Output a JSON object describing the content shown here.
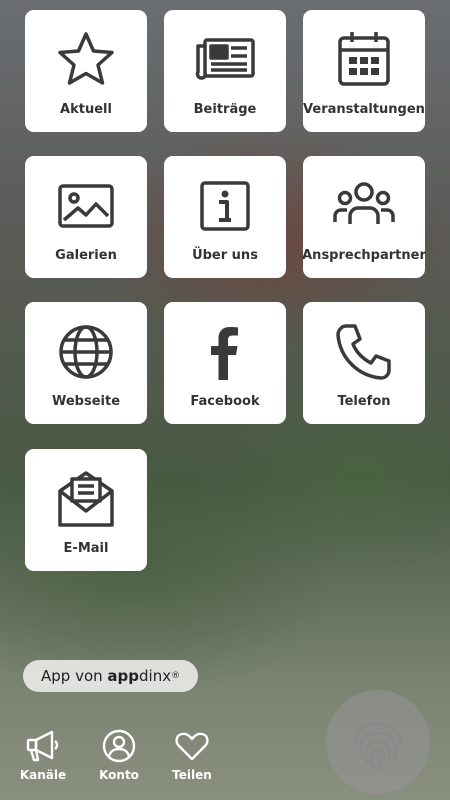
{
  "tiles": [
    {
      "label": "Aktuell",
      "icon": "star-icon"
    },
    {
      "label": "Beiträge",
      "icon": "newspaper-icon"
    },
    {
      "label": "Veranstaltungen",
      "icon": "calendar-icon"
    },
    {
      "label": "Galerien",
      "icon": "image-icon"
    },
    {
      "label": "Über uns",
      "icon": "info-icon"
    },
    {
      "label": "Ansprechpartner",
      "icon": "people-icon"
    },
    {
      "label": "Webseite",
      "icon": "globe-icon"
    },
    {
      "label": "Facebook",
      "icon": "facebook-icon"
    },
    {
      "label": "Telefon",
      "icon": "phone-icon"
    },
    {
      "label": "E-Mail",
      "icon": "email-icon"
    }
  ],
  "branding": {
    "prefix": "App von ",
    "brand_bold": "app",
    "brand_rest": "dinx",
    "registered": "®"
  },
  "nav": [
    {
      "label": "Kanäle",
      "icon": "megaphone-icon"
    },
    {
      "label": "Konto",
      "icon": "account-icon"
    },
    {
      "label": "Teilen",
      "icon": "heart-icon"
    }
  ],
  "fab": {
    "icon": "fingerprint-icon"
  },
  "colors": {
    "tile_bg": "#ffffff",
    "icon": "#3a3a3a",
    "nav_text": "#ffffff"
  }
}
